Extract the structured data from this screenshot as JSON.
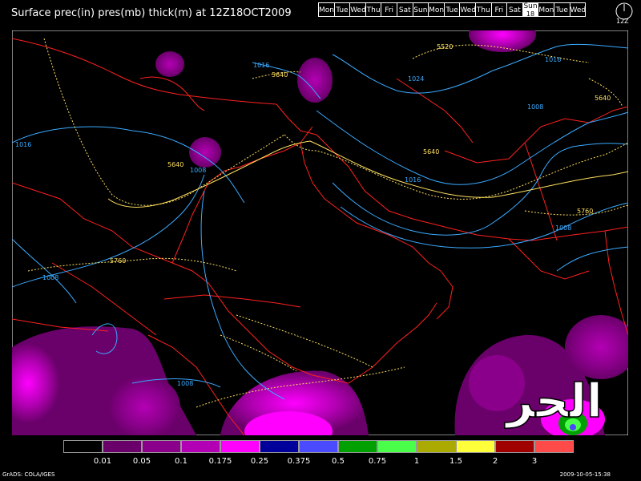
{
  "title": "Surface prec(in) pres(mb) thick(m) at 12Z18OCT2009",
  "days": [
    {
      "label": "Mon"
    },
    {
      "label": "Tue"
    },
    {
      "label": "Wed"
    },
    {
      "label": "Thu"
    },
    {
      "label": "Fri"
    },
    {
      "label": "Sat"
    },
    {
      "label": "Sun"
    },
    {
      "label": "Mon"
    },
    {
      "label": "Tue"
    },
    {
      "label": "Wed"
    },
    {
      "label": "Thu"
    },
    {
      "label": "Fri"
    },
    {
      "label": "Sat"
    },
    {
      "label": "Sun",
      "sub": "18",
      "active": true
    },
    {
      "label": "Mon"
    },
    {
      "label": "Tue"
    },
    {
      "label": "Wed"
    }
  ],
  "clock_label": "12Z",
  "contour_labels": {
    "p1016a": "1016",
    "p1016b": "1016",
    "p1016c": "1016",
    "p1016d": "1016",
    "p1008a": "1008",
    "p1008b": "1008",
    "p1008c": "1008",
    "p1008d": "1008",
    "p1008e": "1008",
    "p1024": "1024",
    "t5520": "5520",
    "t5640a": "5640",
    "t5640b": "5640",
    "t5640c": "5640",
    "t5640d": "5640",
    "t5760a": "5760",
    "t5760b": "5760"
  },
  "legend": {
    "colors": [
      "#000000",
      "#6a006a",
      "#8a008a",
      "#b400b4",
      "#ff00ff",
      "#00009a",
      "#4a4aff",
      "#00a000",
      "#4aff4a",
      "#aaaa00",
      "#ffff3a",
      "#a00000",
      "#ff4a4a"
    ],
    "labels": [
      "0.01",
      "0.05",
      "0.1",
      "0.175",
      "0.25",
      "0.375",
      "0.5",
      "0.75",
      "1",
      "1.5",
      "2",
      "3"
    ]
  },
  "footer_left": "GrADS: COLA/IGES",
  "footer_right": "2009-10-05-15:38",
  "watermark": "الحر",
  "colors": {
    "pressure": "#3aaaff",
    "thickness": "#ffe060",
    "borders": "#ff2020"
  }
}
